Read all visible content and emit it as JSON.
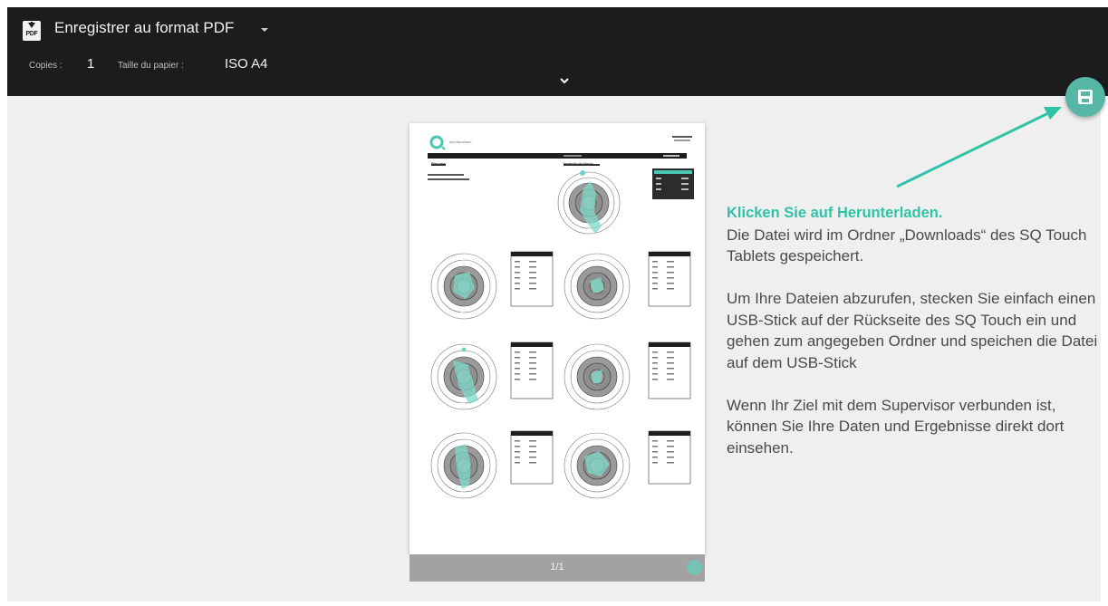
{
  "print_header": {
    "destination_label": "Enregistrer au format PDF",
    "destination_icon": "pdf-download-icon",
    "copies_label": "Copies :",
    "copies_value": "1",
    "paper_label": "Taille du papier :",
    "paper_value": "ISO A4"
  },
  "fab": {
    "icon": "save-icon",
    "color": "#56b7a7"
  },
  "preview": {
    "page_number": "1/1",
    "brand_text": "sportquantum",
    "section_title": "Résumé",
    "impact_title": "Impacts du tireur"
  },
  "instructions": {
    "heading": "Klicken Sie auf Herunterladen.",
    "para1": "Die Datei wird im Ordner „Downloads“ des SQ Touch Tablets gespeichert.",
    "para2": "Um Ihre Dateien abzurufen, stecken Sie einfach einen USB-Stick auf der Rückseite des SQ Touch ein und gehen zum angegeben Ordner und speichen die Datei auf dem USB-Stick",
    "para3": "Wenn Ihr Ziel mit dem Supervisor verbunden ist, können Sie Ihre Daten und Ergebnisse direkt dort einsehen."
  },
  "colors": {
    "accent": "#2ec3a6",
    "header_bg": "#1c1c1c",
    "preview_bg": "#efefef"
  }
}
